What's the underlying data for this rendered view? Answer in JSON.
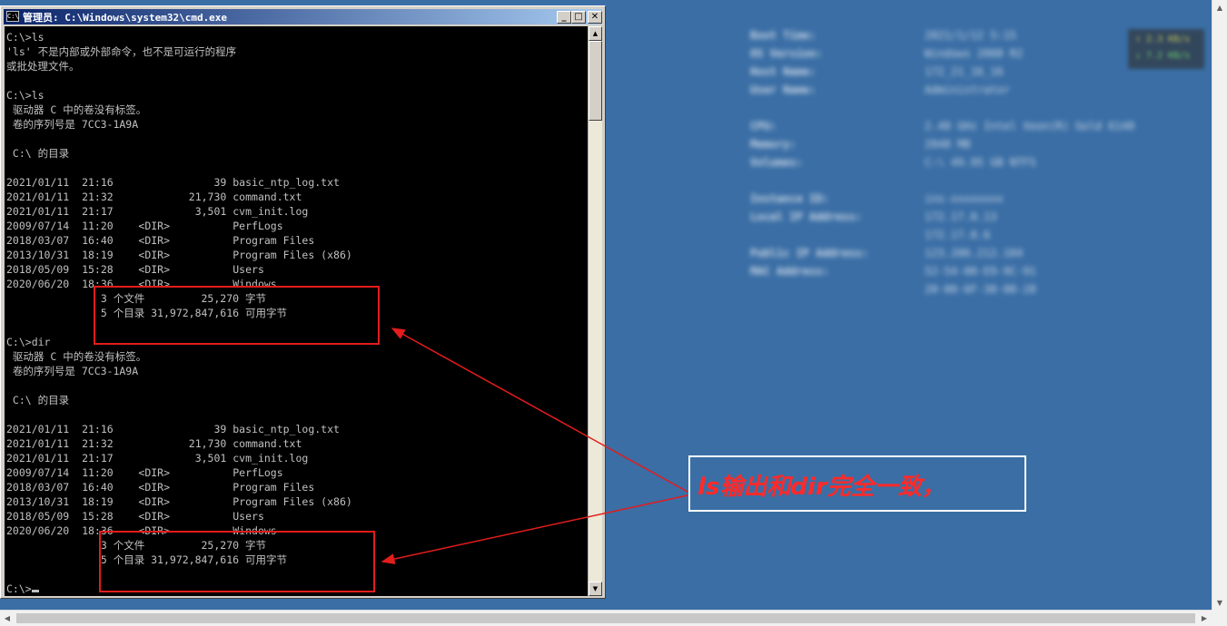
{
  "window": {
    "title": "管理员: C:\\Windows\\system32\\cmd.exe",
    "icon_label": "C:\\",
    "controls": {
      "minimize": "_",
      "maximize": "□",
      "close": "✕"
    }
  },
  "console": {
    "lines": [
      "C:\\>ls",
      "'ls' 不是内部或外部命令，也不是可运行的程序",
      "或批处理文件。",
      "",
      "C:\\>ls",
      " 驱动器 C 中的卷没有标签。",
      " 卷的序列号是 7CC3-1A9A",
      "",
      " C:\\ 的目录",
      "",
      "2021/01/11  21:16                39 basic_ntp_log.txt",
      "2021/01/11  21:32            21,730 command.txt",
      "2021/01/11  21:17             3,501 cvm_init.log",
      "2009/07/14  11:20    <DIR>          PerfLogs",
      "2018/03/07  16:40    <DIR>          Program Files",
      "2013/10/31  18:19    <DIR>          Program Files (x86)",
      "2018/05/09  15:28    <DIR>          Users",
      "2020/06/20  18:36    <DIR>          Windows",
      "               3 个文件         25,270 字节",
      "               5 个目录 31,972,847,616 可用字节",
      "",
      "C:\\>dir",
      " 驱动器 C 中的卷没有标签。",
      " 卷的序列号是 7CC3-1A9A",
      "",
      " C:\\ 的目录",
      "",
      "2021/01/11  21:16                39 basic_ntp_log.txt",
      "2021/01/11  21:32            21,730 command.txt",
      "2021/01/11  21:17             3,501 cvm_init.log",
      "2009/07/14  11:20    <DIR>          PerfLogs",
      "2018/03/07  16:40    <DIR>          Program Files",
      "2013/10/31  18:19    <DIR>          Program Files (x86)",
      "2018/05/09  15:28    <DIR>          Users",
      "2020/06/20  18:36    <DIR>          Windows",
      "               3 个文件         25,270 字节",
      "               5 个目录 31,972,847,616 可用字节",
      "",
      "C:\\>"
    ]
  },
  "annotation": {
    "text": "ls输出和dir完全一致，",
    "color": "#e31c1c"
  },
  "bginfo": [
    {
      "label": "Boot Time:",
      "value": "2021/1/12 5:15"
    },
    {
      "label": "OS Version:",
      "value": "Windows 2008 R2"
    },
    {
      "label": "Host Name:",
      "value": "172_21_16_16"
    },
    {
      "label": "User Name:",
      "value": "Administrator"
    },
    {
      "label": "CPU:",
      "value": "2.40 GHz Intel Xeon(R) Gold 6148"
    },
    {
      "label": "Memory:",
      "value": "2048 MB"
    },
    {
      "label": "Volumes:",
      "value": "C:\\ 49.95 GB NTFS"
    },
    {
      "label": "Instance ID:",
      "value": "ins-xxxxxxxx"
    },
    {
      "label": "Local IP Address:",
      "value": "172.17.0.13"
    },
    {
      "label": "",
      "value": "172.17.0.6"
    },
    {
      "label": "Public IP Address:",
      "value": "123.206.212.104"
    },
    {
      "label": "MAC Address:",
      "value": "52-54-00-E9-9C-91"
    },
    {
      "label": "",
      "value": "20-00-6F-38-08-28"
    }
  ],
  "tray": {
    "up": "↑ 2.3 KB/s",
    "down": "↓ 7.2 KB/s"
  },
  "colors": {
    "desktop": "#3a6ea5",
    "console_bg": "#000000",
    "console_fg": "#c0c0c0",
    "titlebar_start": "#0a246a",
    "titlebar_end": "#a6caf0"
  }
}
